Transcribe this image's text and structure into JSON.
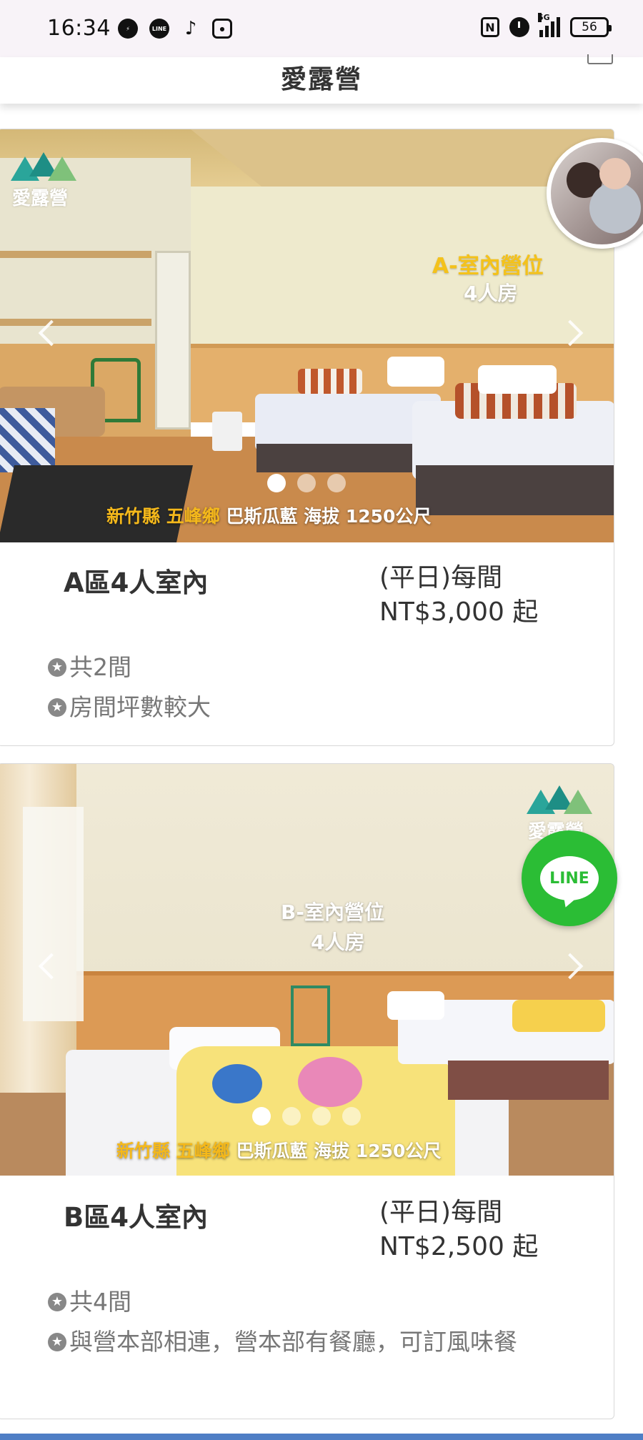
{
  "status_bar": {
    "time": "16:34",
    "apps": [
      "messenger-icon",
      "line-icon",
      "tiktok-icon",
      "instagram-icon"
    ],
    "nfc": "N",
    "network": "5G",
    "battery": "56"
  },
  "header": {
    "title": "愛露營"
  },
  "rooms": [
    {
      "watermark": "愛露營",
      "overlay_title": "A-室內營位",
      "overlay_subtitle": "4人房",
      "location_yellow": "新竹縣 五峰鄉",
      "location_white": "巴斯瓜藍 海拔 1250公尺",
      "slide_count": 3,
      "active_slide": 1,
      "name": "A區4人室內",
      "price_line1": "(平日)每間",
      "price_line2": "NT$3,000 起",
      "features": [
        "共2間",
        "房間坪數較大"
      ]
    },
    {
      "watermark": "愛露營",
      "overlay_title": "B-室內營位",
      "overlay_subtitle": "4人房",
      "location_yellow": "新竹縣 五峰鄉",
      "location_white": "巴斯瓜藍 海拔 1250公尺",
      "slide_count": 4,
      "active_slide": 1,
      "name": "B區4人室內",
      "price_line1": "(平日)每間",
      "price_line2": "NT$2,500 起",
      "features": [
        "共4間",
        "與營本部相連，營本部有餐廳，可訂風味餐"
      ]
    }
  ],
  "floating": {
    "line_label": "LINE"
  },
  "colors": {
    "line_green": "#2bbd35",
    "accent_yellow": "#f4c21b",
    "watermark_teal": "#2aa59a"
  }
}
